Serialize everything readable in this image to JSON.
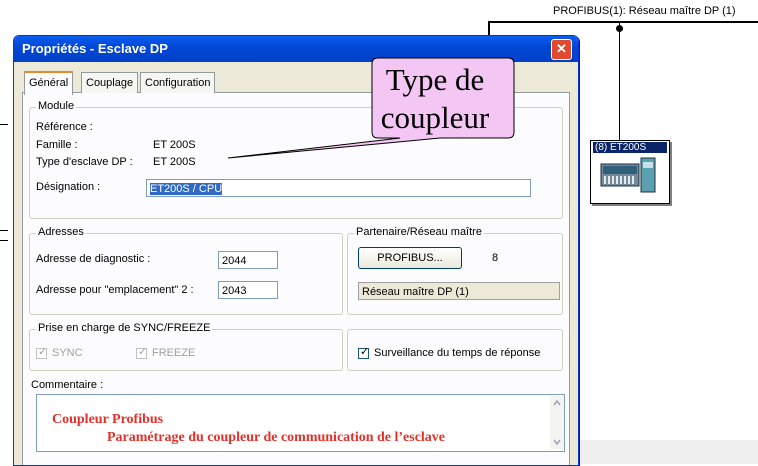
{
  "network": {
    "bus_label": "PROFIBUS(1): Réseau maître DP (1)",
    "slave_title": "(8) ET200S"
  },
  "dialog": {
    "title": "Propriétés - Esclave DP",
    "close_glyph": "✕",
    "tabs": [
      {
        "label": "Général",
        "active": true
      },
      {
        "label": "Couplage",
        "active": false
      },
      {
        "label": "Configuration",
        "active": false
      }
    ],
    "module": {
      "legend": "Module",
      "reference_label": "Référence :",
      "reference_value": "",
      "family_label": "Famille :",
      "family_value": "ET 200S",
      "type_label": "Type d'esclave DP :",
      "type_value": "ET 200S",
      "designation_label": "Désignation :",
      "designation_value": "ET200S / CPU"
    },
    "addresses": {
      "legend": "Adresses",
      "diag_label": "Adresse de diagnostic :",
      "diag_value": "2044",
      "slot2_label": "Adresse pour \"emplacement\" 2 :",
      "slot2_value": "2043"
    },
    "partner": {
      "legend": "Partenaire/Réseau maître",
      "button_label": "PROFIBUS...",
      "address_value": "8",
      "network_value": "Réseau maître DP (1)"
    },
    "sync_freeze": {
      "legend": "Prise en charge de SYNC/FREEZE",
      "sync_label": "SYNC",
      "sync_checked": true,
      "freeze_label": "FREEZE",
      "freeze_checked": true
    },
    "watchdog": {
      "label": "Surveillance du temps de réponse",
      "checked": true
    },
    "comment": {
      "label": "Commentaire :",
      "line1": "Coupleur Profibus",
      "line2": "Paramétrage du coupleur de communication de l’esclave"
    }
  },
  "callout": {
    "line1": "Type de",
    "line2": "coupleur"
  },
  "colors": {
    "title_bar": "#0047d6",
    "dialog_bg": "#ece9d8",
    "comment_text": "#e3312a",
    "callout_fill": "#f3c6f3",
    "designation_highlight": "#316ac5"
  }
}
